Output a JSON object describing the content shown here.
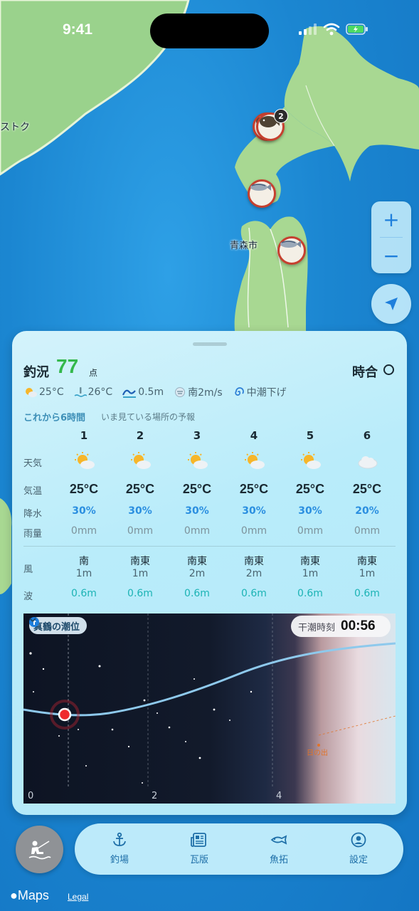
{
  "status_bar": {
    "time": "9:41"
  },
  "map": {
    "labels": {
      "city": "青森市",
      "left_edge": "ストク"
    },
    "pins": [
      {
        "fish": "flounder-icon",
        "badge": "2"
      },
      {
        "fish": "mackerel-icon"
      },
      {
        "fish": "mackerel-icon"
      }
    ],
    "zoom_in": "+",
    "zoom_out": "−"
  },
  "sheet": {
    "fishing_label": "釣況",
    "score": "77",
    "score_unit": "点",
    "jiai_label": "時合",
    "conditions": {
      "air_temp": "25°C",
      "water_temp": "26°C",
      "wave": "0.5m",
      "wind": "南2m/s",
      "tide": "中潮下げ"
    },
    "forecast_title": "これから6時間",
    "forecast_subtitle": "いま見ている場所の予報",
    "row_labels": {
      "weather": "天気",
      "temp": "気温",
      "precip": "降水",
      "rain": "雨量",
      "wind": "風",
      "wave": "波"
    },
    "hours": [
      {
        "hour": "1",
        "weather": "sun-cloud-icon",
        "temp": "25°C",
        "precip": "30%",
        "rain": "0mm",
        "wind_dir": "南",
        "wind_speed": "1m",
        "wave": "0.6m"
      },
      {
        "hour": "2",
        "weather": "sun-cloud-icon",
        "temp": "25°C",
        "precip": "30%",
        "rain": "0mm",
        "wind_dir": "南東",
        "wind_speed": "1m",
        "wave": "0.6m"
      },
      {
        "hour": "3",
        "weather": "sun-cloud-icon",
        "temp": "25°C",
        "precip": "30%",
        "rain": "0mm",
        "wind_dir": "南東",
        "wind_speed": "2m",
        "wave": "0.6m"
      },
      {
        "hour": "4",
        "weather": "sun-cloud-icon",
        "temp": "25°C",
        "precip": "30%",
        "rain": "0mm",
        "wind_dir": "南東",
        "wind_speed": "2m",
        "wave": "0.6m"
      },
      {
        "hour": "5",
        "weather": "sun-cloud-icon",
        "temp": "25°C",
        "precip": "30%",
        "rain": "0mm",
        "wind_dir": "南東",
        "wind_speed": "1m",
        "wave": "0.6m"
      },
      {
        "hour": "6",
        "weather": "cloud-icon",
        "temp": "25°C",
        "precip": "20%",
        "rain": "0mm",
        "wind_dir": "南東",
        "wind_speed": "1m",
        "wave": "0.6m"
      }
    ],
    "tide": {
      "station": "真鶴の潮位",
      "time_label": "干潮時刻",
      "time_value": "00:56",
      "sunrise_label": "日の出",
      "ticks": [
        "0",
        "2",
        "4"
      ]
    }
  },
  "tab_bar": {
    "tabs": [
      {
        "label": "釣場",
        "icon": "anchor-icon"
      },
      {
        "label": "瓦版",
        "icon": "newspaper-icon"
      },
      {
        "label": "魚拓",
        "icon": "fish-icon"
      },
      {
        "label": "設定",
        "icon": "profile-icon"
      }
    ]
  },
  "footer": {
    "maps": "Maps",
    "legal": "Legal"
  },
  "colors": {
    "score_green": "#34b84c",
    "accent_blue": "#1e7fdc",
    "precip_blue": "#2b8fe0",
    "wave_teal": "#1cb3b5",
    "pin_red": "#c6402f"
  }
}
